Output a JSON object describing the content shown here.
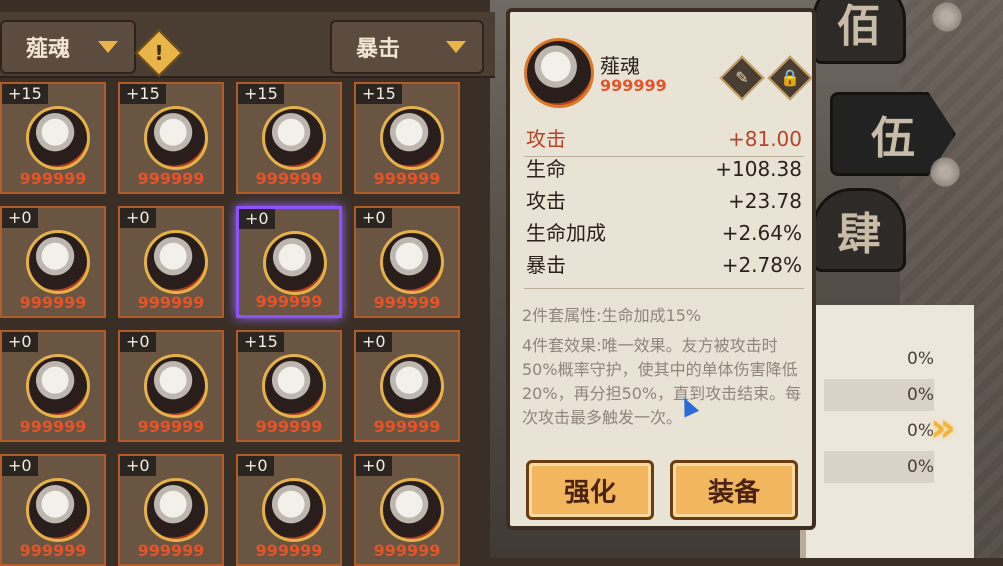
{
  "filters": {
    "left_label": "薤魂",
    "right_label": "暴击",
    "warn_icon": "!"
  },
  "grid": [
    {
      "level": "+15"
    },
    {
      "level": "+15"
    },
    {
      "level": "+15"
    },
    {
      "level": "+15"
    },
    {
      "level": "+0"
    },
    {
      "level": "+0"
    },
    {
      "level": "+0"
    },
    {
      "level": "+0"
    },
    {
      "level": "+0"
    },
    {
      "level": "+0"
    },
    {
      "level": "+15"
    },
    {
      "level": "+0"
    },
    {
      "level": "+0"
    },
    {
      "level": "+0"
    },
    {
      "level": "+0"
    },
    {
      "level": "+0"
    }
  ],
  "stars": "999999",
  "detail": {
    "name": "薤魂",
    "stars": "999999",
    "stats": [
      {
        "key": "攻击",
        "value": "+81.00",
        "main": true
      },
      {
        "key": "生命",
        "value": "+108.38"
      },
      {
        "key": "攻击",
        "value": "+23.78"
      },
      {
        "key": "生命加成",
        "value": "+2.64%"
      },
      {
        "key": "暴击",
        "value": "+2.78%"
      }
    ],
    "set2": "2件套属性:生命加成15%",
    "set4": "4件套效果:唯一效果。友方被攻击时50%概率守护，使其中的单体伤害降低20%，再分担50%，直到攻击结束。每次攻击最多触发一次。",
    "enhance_label": "强化",
    "equip_label": "装备"
  },
  "background": {
    "pillars": [
      "伍",
      "肆",
      "佰"
    ],
    "scroll_values": [
      "0%",
      "0%",
      "0%",
      "0%"
    ]
  }
}
